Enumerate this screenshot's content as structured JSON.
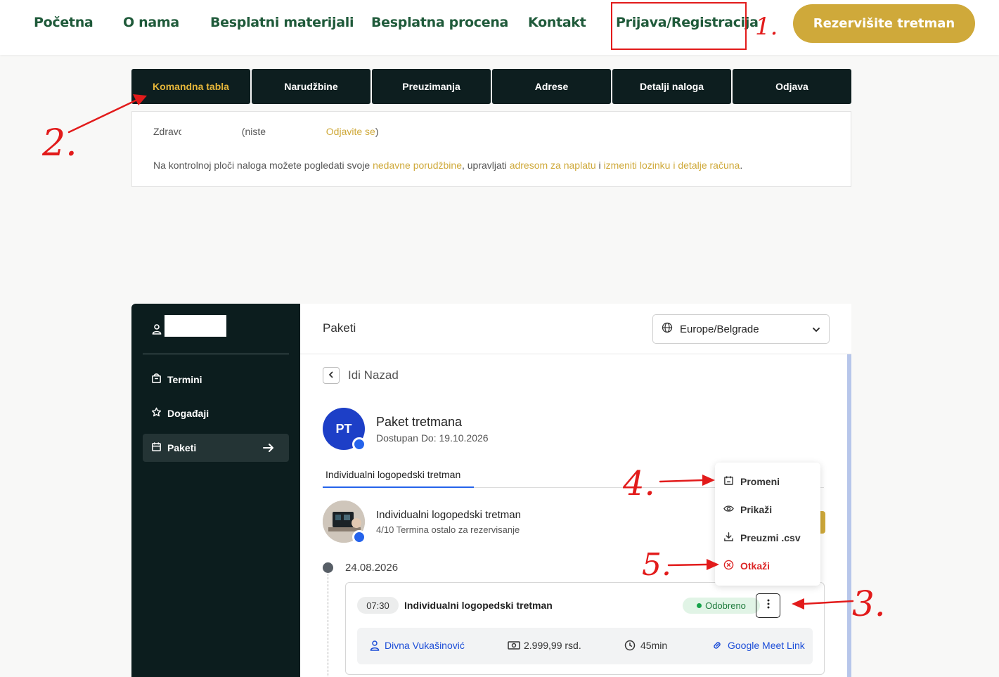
{
  "nav": {
    "links": [
      "Početna",
      "O nama",
      "Besplatni materijali",
      "Besplatna procena",
      "Kontakt",
      "Prijava/Registracija"
    ],
    "book_button": "Rezervišite tretman"
  },
  "account_tabs": [
    "Komandna tabla",
    "Narudžbine",
    "Preuzimanja",
    "Adrese",
    "Detalji naloga",
    "Odjava"
  ],
  "account_box": {
    "greeting_start": "Zdravo",
    "not_you": "(niste",
    "logout_link": "Odjavite se",
    "close_paren": ")",
    "text_1": "Na kontrolnoj ploči naloga možete pogledati svoje ",
    "link_orders": "nedavne porudžbine",
    "text_2": ", upravljati ",
    "link_address": "adresom za naplatu",
    "text_3": " i ",
    "link_password": "izmeniti lozinku i detalje računa",
    "text_4": "."
  },
  "sidebar": {
    "items": [
      {
        "label": "Termini",
        "icon": "bag-icon"
      },
      {
        "label": "Događaji",
        "icon": "star-icon"
      },
      {
        "label": "Paketi",
        "icon": "calendar-icon"
      }
    ]
  },
  "main": {
    "title": "Paketi",
    "timezone": "Europe/Belgrade",
    "back_label": "Idi Nazad",
    "package": {
      "initials": "PT",
      "name": "Paket tretmana",
      "available_until": "Dostupan Do: 19.10.2026"
    },
    "tab_label": "Individualni logopedski tretman",
    "service": {
      "name": "Individualni logopedski tretman",
      "remaining": "4/10 Termina ostalo za rezervisanje"
    },
    "date": "24.08.2026",
    "appointment": {
      "time": "07:30",
      "name": "Individualni logopedski tretman",
      "status": "Odobreno",
      "employee": "Divna Vukašinović",
      "price": "2.999,99 rsd.",
      "duration": "45min",
      "meet_link": "Google Meet Link"
    }
  },
  "menu": {
    "items": [
      "Promeni",
      "Prikaži",
      "Preuzmi .csv",
      "Otkaži"
    ]
  },
  "annotations": [
    "1.",
    "2.",
    "3.",
    "4.",
    "5."
  ],
  "colors": {
    "dark": "#0d1e1f",
    "gold": "#cfa93a",
    "nav_green": "#1f5a3a",
    "blue": "#1d4ed8",
    "annotation_red": "#e21b1b",
    "success": "#16a34a",
    "danger": "#dc2626"
  }
}
